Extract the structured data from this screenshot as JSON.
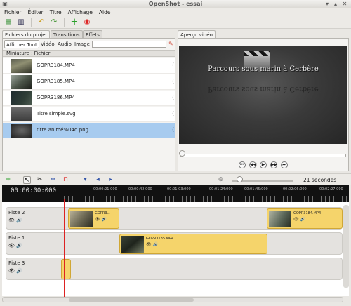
{
  "window": {
    "title": "OpenShot - essai"
  },
  "menu": [
    "Fichier",
    "Éditer",
    "Titre",
    "Affichage",
    "Aide"
  ],
  "left_tabs": [
    "Fichiers du projet",
    "Transitions",
    "Effets"
  ],
  "filters": [
    "Afficher Tout",
    "Vidéo",
    "Audio",
    "Image"
  ],
  "search": {
    "value": "",
    "placeholder": ""
  },
  "file_list": {
    "column_header": "Miniature : Fichier",
    "rows": [
      {
        "name": "GOPR3184.MP4",
        "tail": "("
      },
      {
        "name": "GOPR3185.MP4",
        "tail": "("
      },
      {
        "name": "GOPR3186.MP4",
        "tail": "("
      },
      {
        "name": "Titre simple.svg",
        "tail": "("
      },
      {
        "name": "titre animé%04d.png",
        "tail": "("
      }
    ],
    "selected_index": 4
  },
  "preview": {
    "tab": "Aperçu vidéo",
    "video_title": "Parcours sous marin à Cerbère"
  },
  "timeline": {
    "zoom_label": "21 secondes",
    "timecode": "00:00:00:000",
    "ruler_ticks": [
      "00:00:21:000",
      "00:00:42:000",
      "00:01:03:000",
      "00:01:24:000",
      "00:01:45:000",
      "00:02:06:000",
      "00:02:27:000"
    ],
    "tracks": [
      {
        "name": "Piste 2",
        "clips": [
          "GOPR3...",
          "GOPR3184.MP4"
        ]
      },
      {
        "name": "Piste 1",
        "clips": [
          "GOPR3185.MP4"
        ]
      },
      {
        "name": "Piste 3",
        "clips": [
          ""
        ]
      }
    ]
  },
  "colors": {
    "selection": "#a7cbef",
    "clip": "#f5d46b",
    "playhead": "#dd2222",
    "ruler": "#111111"
  }
}
